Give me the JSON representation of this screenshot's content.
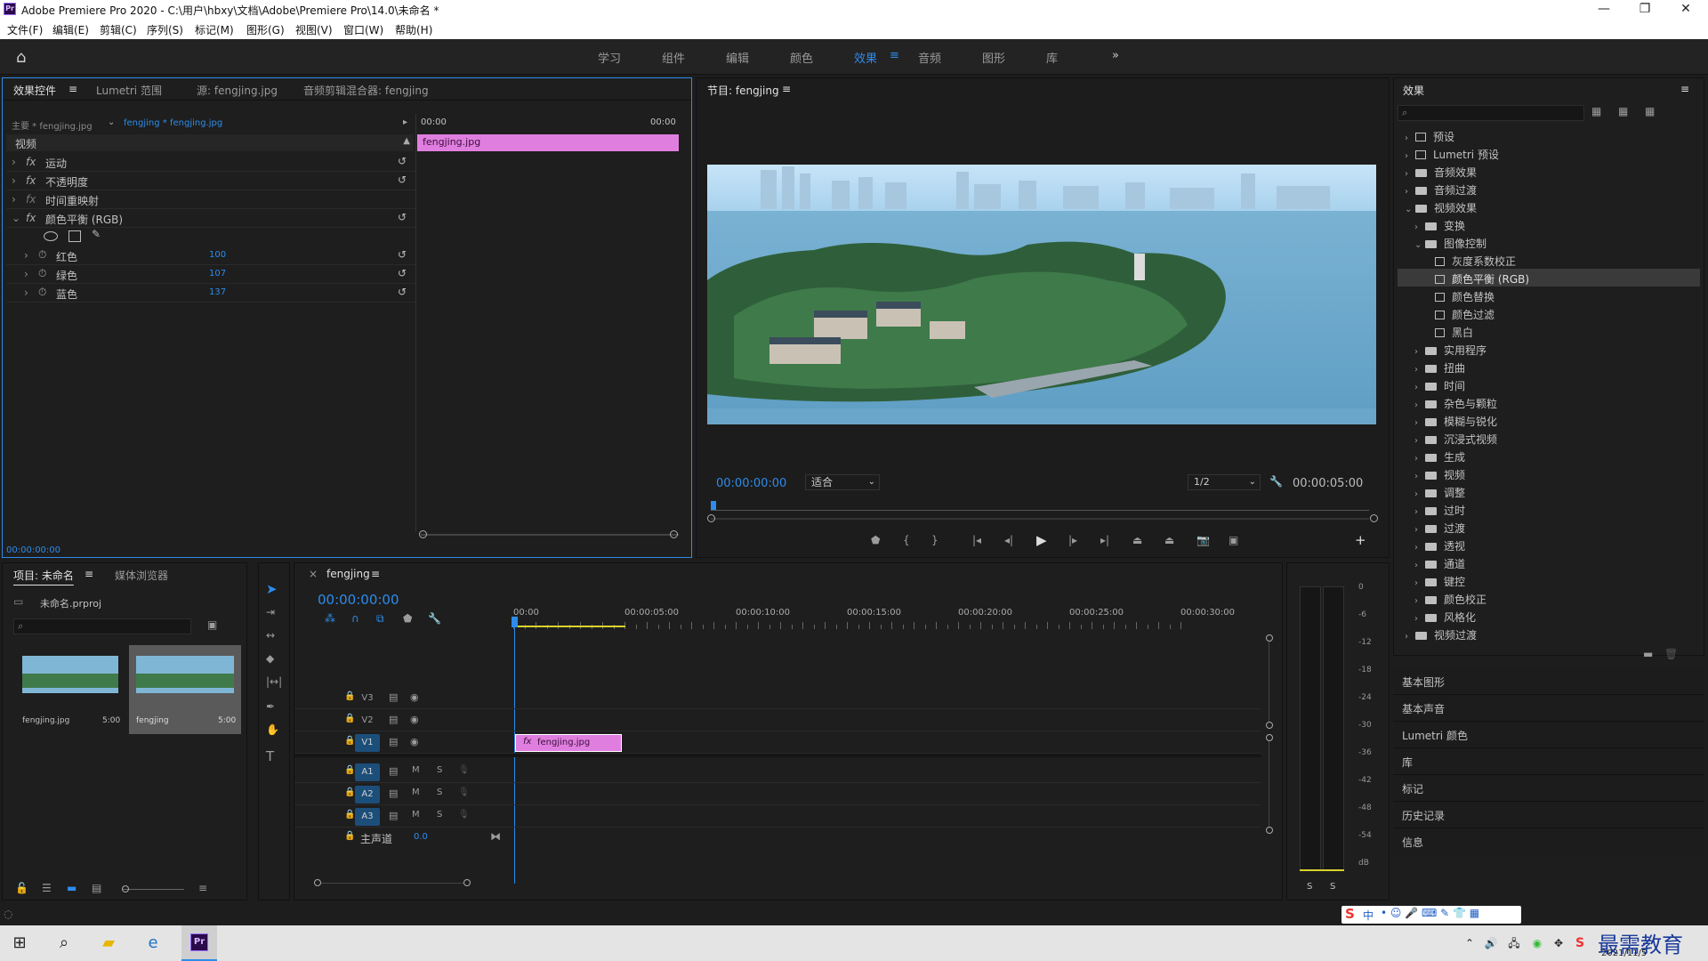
{
  "window": {
    "title": "Adobe Premiere Pro 2020 - C:\\用户\\hbxy\\文档\\Adobe\\Premiere Pro\\14.0\\未命名 *",
    "app_icon": "Pr",
    "controls": {
      "minimize": "—",
      "maximize": "❐",
      "close": "✕"
    }
  },
  "menu": [
    "文件(F)",
    "编辑(E)",
    "剪辑(C)",
    "序列(S)",
    "标记(M)",
    "图形(G)",
    "视图(V)",
    "窗口(W)",
    "帮助(H)"
  ],
  "workspaces": {
    "items": [
      "学习",
      "组件",
      "编辑",
      "颜色",
      "效果",
      "音频",
      "图形",
      "库"
    ],
    "active": "效果",
    "more": "»"
  },
  "effect_controls": {
    "tabs": [
      "效果控件",
      "Lumetri 范围",
      "源: fengjing.jpg",
      "音频剪辑混合器: fengjing"
    ],
    "master": "主要 * fengjing.jpg",
    "clip": "fengjing * fengjing.jpg",
    "time_start": "00:00",
    "time_end": "00:00",
    "clip_bar": "fengjing.jpg",
    "section": "视频",
    "effects": [
      {
        "name": "运动"
      },
      {
        "name": "不透明度"
      },
      {
        "name": "时间重映射"
      },
      {
        "name": "颜色平衡 (RGB)"
      }
    ],
    "params": [
      {
        "name": "红色",
        "value": "100"
      },
      {
        "name": "绿色",
        "value": "107"
      },
      {
        "name": "蓝色",
        "value": "137"
      }
    ],
    "timecode": "00:00:00:00"
  },
  "program": {
    "tab": "节目: fengjing",
    "timecode": "00:00:00:00",
    "fit": "适合",
    "resolution": "1/2",
    "duration": "00:00:05:00"
  },
  "effects_panel": {
    "title": "效果",
    "tree": [
      {
        "label": "预设",
        "level": 0,
        "type": "preset",
        "open": false
      },
      {
        "label": "Lumetri 预设",
        "level": 0,
        "type": "preset",
        "open": false
      },
      {
        "label": "音频效果",
        "level": 0,
        "type": "folder",
        "open": false
      },
      {
        "label": "音频过渡",
        "level": 0,
        "type": "folder",
        "open": false
      },
      {
        "label": "视频效果",
        "level": 0,
        "type": "folder",
        "open": true
      },
      {
        "label": "变换",
        "level": 1,
        "type": "folder",
        "open": false
      },
      {
        "label": "图像控制",
        "level": 1,
        "type": "folder",
        "open": true
      },
      {
        "label": "灰度系数校正",
        "level": 2,
        "type": "item"
      },
      {
        "label": "颜色平衡 (RGB)",
        "level": 2,
        "type": "item",
        "selected": true
      },
      {
        "label": "颜色替换",
        "level": 2,
        "type": "item"
      },
      {
        "label": "颜色过滤",
        "level": 2,
        "type": "item"
      },
      {
        "label": "黑白",
        "level": 2,
        "type": "item"
      },
      {
        "label": "实用程序",
        "level": 1,
        "type": "folder"
      },
      {
        "label": "扭曲",
        "level": 1,
        "type": "folder"
      },
      {
        "label": "时间",
        "level": 1,
        "type": "folder"
      },
      {
        "label": "杂色与颗粒",
        "level": 1,
        "type": "folder"
      },
      {
        "label": "模糊与锐化",
        "level": 1,
        "type": "folder"
      },
      {
        "label": "沉浸式视频",
        "level": 1,
        "type": "folder"
      },
      {
        "label": "生成",
        "level": 1,
        "type": "folder"
      },
      {
        "label": "视频",
        "level": 1,
        "type": "folder"
      },
      {
        "label": "调整",
        "level": 1,
        "type": "folder"
      },
      {
        "label": "过时",
        "level": 1,
        "type": "folder"
      },
      {
        "label": "过渡",
        "level": 1,
        "type": "folder"
      },
      {
        "label": "透视",
        "level": 1,
        "type": "folder"
      },
      {
        "label": "通道",
        "level": 1,
        "type": "folder"
      },
      {
        "label": "键控",
        "level": 1,
        "type": "folder"
      },
      {
        "label": "颜色校正",
        "level": 1,
        "type": "folder"
      },
      {
        "label": "风格化",
        "level": 1,
        "type": "folder"
      },
      {
        "label": "视频过渡",
        "level": 0,
        "type": "folder"
      }
    ],
    "sections": [
      "基本图形",
      "基本声音",
      "Lumetri 颜色",
      "库",
      "标记",
      "历史记录",
      "信息"
    ]
  },
  "project": {
    "tabs": [
      "项目: 未命名",
      "媒体浏览器"
    ],
    "file": "未命名.prproj",
    "items": [
      {
        "name": "fengjing.jpg",
        "duration": "5:00"
      },
      {
        "name": "fengjing",
        "duration": "5:00"
      }
    ]
  },
  "timeline": {
    "tab": "fengjing",
    "timecode": "00:00:00:00",
    "ruler": [
      "00:00",
      "00:00:05:00",
      "00:00:10:00",
      "00:00:15:00",
      "00:00:20:00",
      "00:00:25:00",
      "00:00:30:00"
    ],
    "video_tracks": [
      "V3",
      "V2",
      "V1"
    ],
    "audio_tracks": [
      "A1",
      "A2",
      "A3"
    ],
    "master": "主声道",
    "master_value": "0.0",
    "clip": "fengjing.jpg",
    "m": "M",
    "s": "S"
  },
  "meter": {
    "labels": [
      "0",
      "-6",
      "-12",
      "-18",
      "-24",
      "-30",
      "-36",
      "-42",
      "-48",
      "-54",
      "dB"
    ],
    "solo": [
      "S",
      "S"
    ]
  },
  "taskbar": {
    "date": "2021/11/5",
    "watermark": "最需教育",
    "ime": "中"
  }
}
